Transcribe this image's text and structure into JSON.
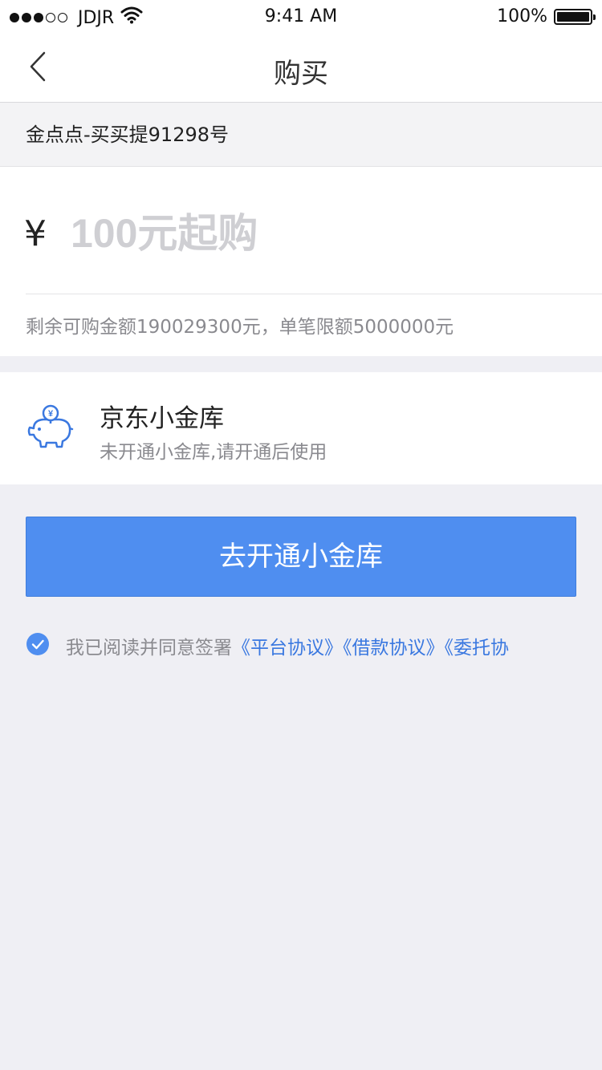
{
  "status_bar": {
    "carrier": "JDJR",
    "time": "9:41 AM",
    "battery": "100%"
  },
  "nav": {
    "title": "购买"
  },
  "product": {
    "name": "金点点-买买提91298号"
  },
  "amount": {
    "currency_symbol": "¥",
    "placeholder": "100元起购",
    "limit_text": "剩余可购金额190029300元，单笔限额5000000元"
  },
  "vault": {
    "title": "京东小金库",
    "subtitle": "未开通小金库,请开通后使用"
  },
  "primary_button": {
    "label": "去开通小金库"
  },
  "agreement": {
    "prefix": "我已阅读并同意签署",
    "links": [
      "《平台协议》",
      "《借款协议》",
      "《委托协"
    ]
  },
  "colors": {
    "accent": "#4f8ef0",
    "link": "#3a78e0",
    "background": "#efeff4"
  }
}
